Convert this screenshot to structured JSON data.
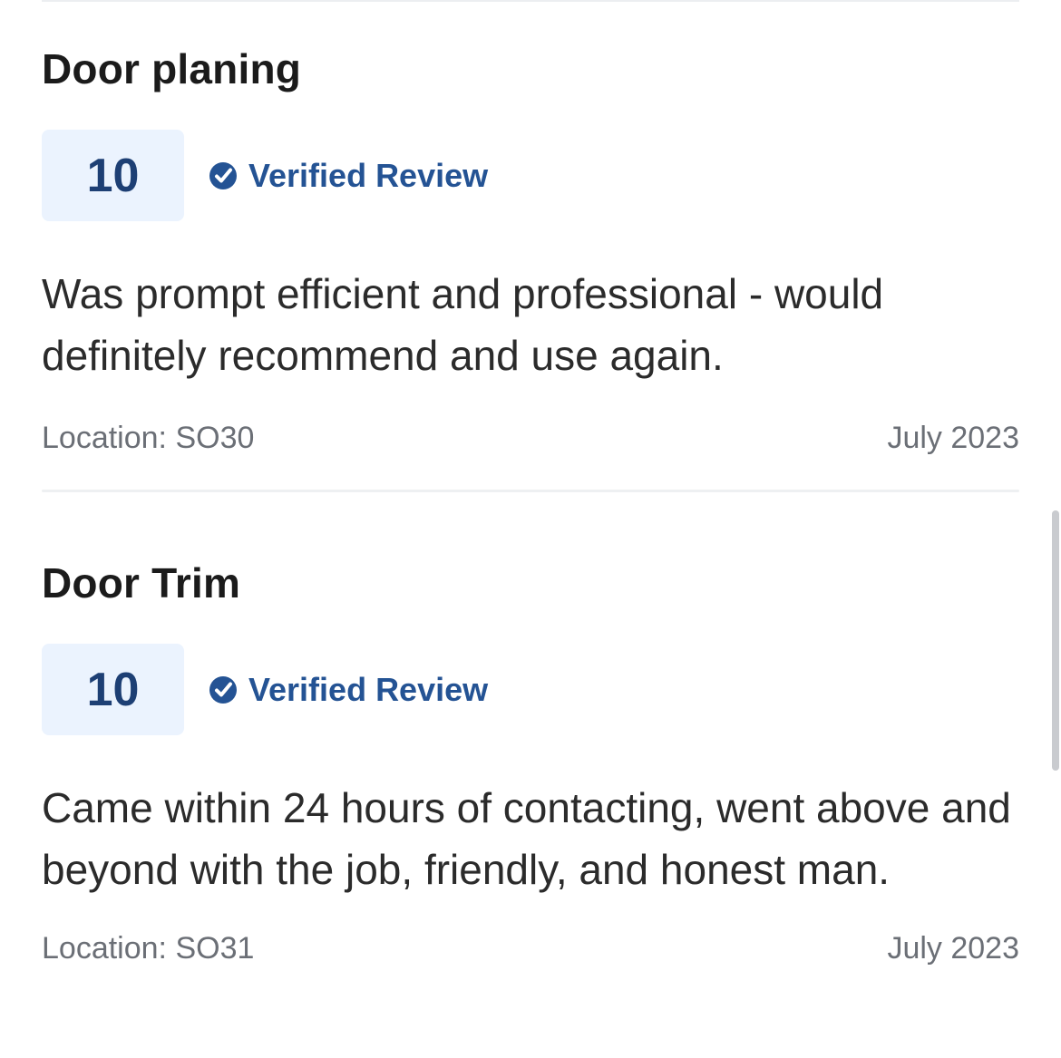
{
  "reviews": [
    {
      "title": "Door planing",
      "score": "10",
      "verified_label": "Verified Review",
      "body": "Was prompt efficient and professional - would definitely recommend and use again.",
      "location": "Location: SO30",
      "date": "July 2023"
    },
    {
      "title": "Door Trim",
      "score": "10",
      "verified_label": "Verified Review",
      "body": "Came within 24 hours of contacting, went above and beyond with the job, friendly, and honest man.",
      "location": "Location: SO31",
      "date": "July 2023"
    }
  ],
  "colors": {
    "score_bg": "#ebf3fe",
    "score_text": "#1d3f74",
    "verified": "#245394",
    "muted": "#6b6f76"
  },
  "icons": {
    "verified": "verified-check-icon"
  }
}
